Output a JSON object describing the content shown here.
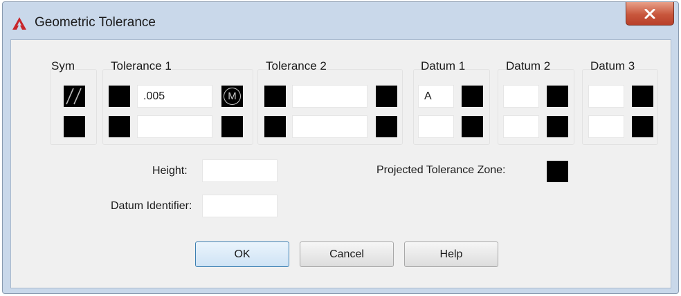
{
  "window": {
    "title": "Geometric Tolerance"
  },
  "columns": {
    "sym": "Sym",
    "tolerance1": "Tolerance 1",
    "tolerance2": "Tolerance 2",
    "datum1": "Datum 1",
    "datum2": "Datum 2",
    "datum3": "Datum 3"
  },
  "rows": [
    {
      "symbol": "//",
      "tolerance1_value": ".005",
      "tolerance1_modifier": "M",
      "tolerance2_value": "",
      "datum1_value": "A",
      "datum2_value": "",
      "datum3_value": ""
    },
    {
      "symbol": "",
      "tolerance1_value": "",
      "tolerance1_modifier": "",
      "tolerance2_value": "",
      "datum1_value": "",
      "datum2_value": "",
      "datum3_value": ""
    }
  ],
  "fields": {
    "height_label": "Height:",
    "height_value": "",
    "datum_identifier_label": "Datum Identifier:",
    "datum_identifier_value": "",
    "projected_tolerance_zone_label": "Projected Tolerance Zone:"
  },
  "buttons": {
    "ok": "OK",
    "cancel": "Cancel",
    "help": "Help"
  },
  "colors": {
    "app_icon": "#c8262b",
    "close_button": "#c8563c",
    "window_frame": "#c9d8ea",
    "client_bg": "#f0f0f0",
    "swatch": "#000000"
  },
  "icons": {
    "app": "autocad-logo-icon",
    "close": "close-icon",
    "symbol_row1": "parallelism-icon",
    "modifier_row1": "mmc-circle-m-icon"
  }
}
